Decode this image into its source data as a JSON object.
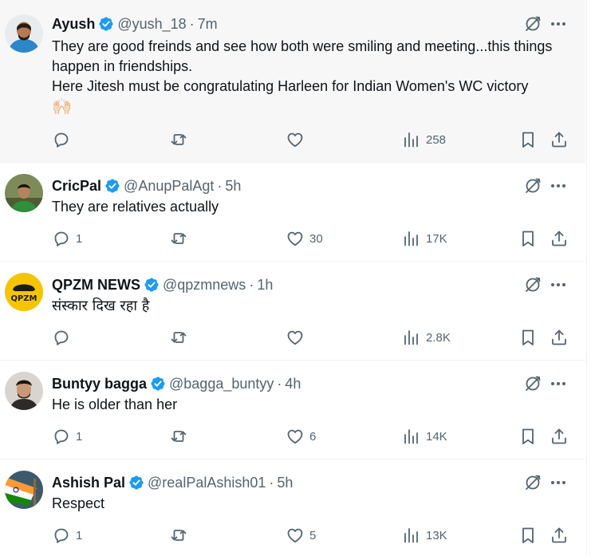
{
  "posts": [
    {
      "name": "Ayush",
      "handle": "@yush_18",
      "time": "7m",
      "text": "They are good freinds and see how both were smiling and meeting...this things happen in friendships.\nHere Jitesh must be congratulating Harleen for Indian Women's WC victory",
      "emoji": "🙌🏻",
      "replies": "",
      "reposts": "",
      "likes": "",
      "views": "258"
    },
    {
      "name": "CricPal",
      "handle": "@AnupPalAgt",
      "time": "5h",
      "text": "They are relatives actually",
      "replies": "1",
      "reposts": "",
      "likes": "30",
      "views": "17K"
    },
    {
      "name": "QPZM NEWS",
      "handle": "@qpzmnews",
      "time": "1h",
      "text": "संस्कार दिख रहा है",
      "avatar_text": "QPZM",
      "replies": "",
      "reposts": "",
      "likes": "",
      "views": "2.8K"
    },
    {
      "name": "Buntyy bagga",
      "handle": "@bagga_buntyy",
      "time": "4h",
      "text": "He is older than her",
      "replies": "1",
      "reposts": "",
      "likes": "6",
      "views": "14K"
    },
    {
      "name": "Ashish Pal",
      "handle": "@realPalAshish01",
      "time": "5h",
      "text": "Respect",
      "replies": "1",
      "reposts": "",
      "likes": "5",
      "views": "13K"
    }
  ],
  "colors": {
    "accent": "#1d9bf0",
    "muted": "#536471",
    "text": "#0f1419",
    "highlight": "#f7f7f7"
  },
  "icons": [
    "verified-badge-icon",
    "grok-icon",
    "more-icon",
    "reply-icon",
    "repost-icon",
    "like-icon",
    "views-icon",
    "bookmark-icon",
    "share-icon"
  ]
}
